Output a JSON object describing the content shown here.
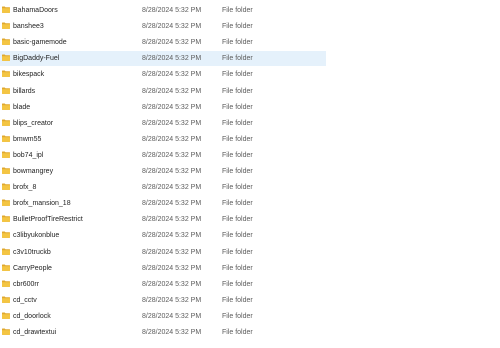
{
  "colors": {
    "folder": "#f4c542",
    "folder_dark": "#e0a82e",
    "hover_bg": "#e5f1fb"
  },
  "icons": {
    "item": "folder-icon"
  },
  "files": [
    {
      "name": "BahamaDoors",
      "date": "8/28/2024 5:32 PM",
      "type": "File folder"
    },
    {
      "name": "banshee3",
      "date": "8/28/2024 5:32 PM",
      "type": "File folder"
    },
    {
      "name": "basic-gamemode",
      "date": "8/28/2024 5:32 PM",
      "type": "File folder"
    },
    {
      "name": "BigDaddy-Fuel",
      "date": "8/28/2024 5:32 PM",
      "type": "File folder",
      "hovered": true
    },
    {
      "name": "bikespack",
      "date": "8/28/2024 5:32 PM",
      "type": "File folder"
    },
    {
      "name": "billards",
      "date": "8/28/2024 5:32 PM",
      "type": "File folder"
    },
    {
      "name": "blade",
      "date": "8/28/2024 5:32 PM",
      "type": "File folder"
    },
    {
      "name": "blips_creator",
      "date": "8/28/2024 5:32 PM",
      "type": "File folder"
    },
    {
      "name": "bmwm55",
      "date": "8/28/2024 5:32 PM",
      "type": "File folder"
    },
    {
      "name": "bob74_ipl",
      "date": "8/28/2024 5:32 PM",
      "type": "File folder"
    },
    {
      "name": "bowmangrey",
      "date": "8/28/2024 5:32 PM",
      "type": "File folder"
    },
    {
      "name": "brofx_8",
      "date": "8/28/2024 5:32 PM",
      "type": "File folder"
    },
    {
      "name": "brofx_mansion_18",
      "date": "8/28/2024 5:32 PM",
      "type": "File folder"
    },
    {
      "name": "BulletProofTireRestrict",
      "date": "8/28/2024 5:32 PM",
      "type": "File folder"
    },
    {
      "name": "c3libyukonblue",
      "date": "8/28/2024 5:32 PM",
      "type": "File folder"
    },
    {
      "name": "c3v10truckb",
      "date": "8/28/2024 5:32 PM",
      "type": "File folder"
    },
    {
      "name": "CarryPeople",
      "date": "8/28/2024 5:32 PM",
      "type": "File folder"
    },
    {
      "name": "cbr600rr",
      "date": "8/28/2024 5:32 PM",
      "type": "File folder"
    },
    {
      "name": "cd_cctv",
      "date": "8/28/2024 5:32 PM",
      "type": "File folder"
    },
    {
      "name": "cd_doorlock",
      "date": "8/28/2024 5:32 PM",
      "type": "File folder"
    },
    {
      "name": "cd_drawtextui",
      "date": "8/28/2024 5:32 PM",
      "type": "File folder"
    }
  ]
}
